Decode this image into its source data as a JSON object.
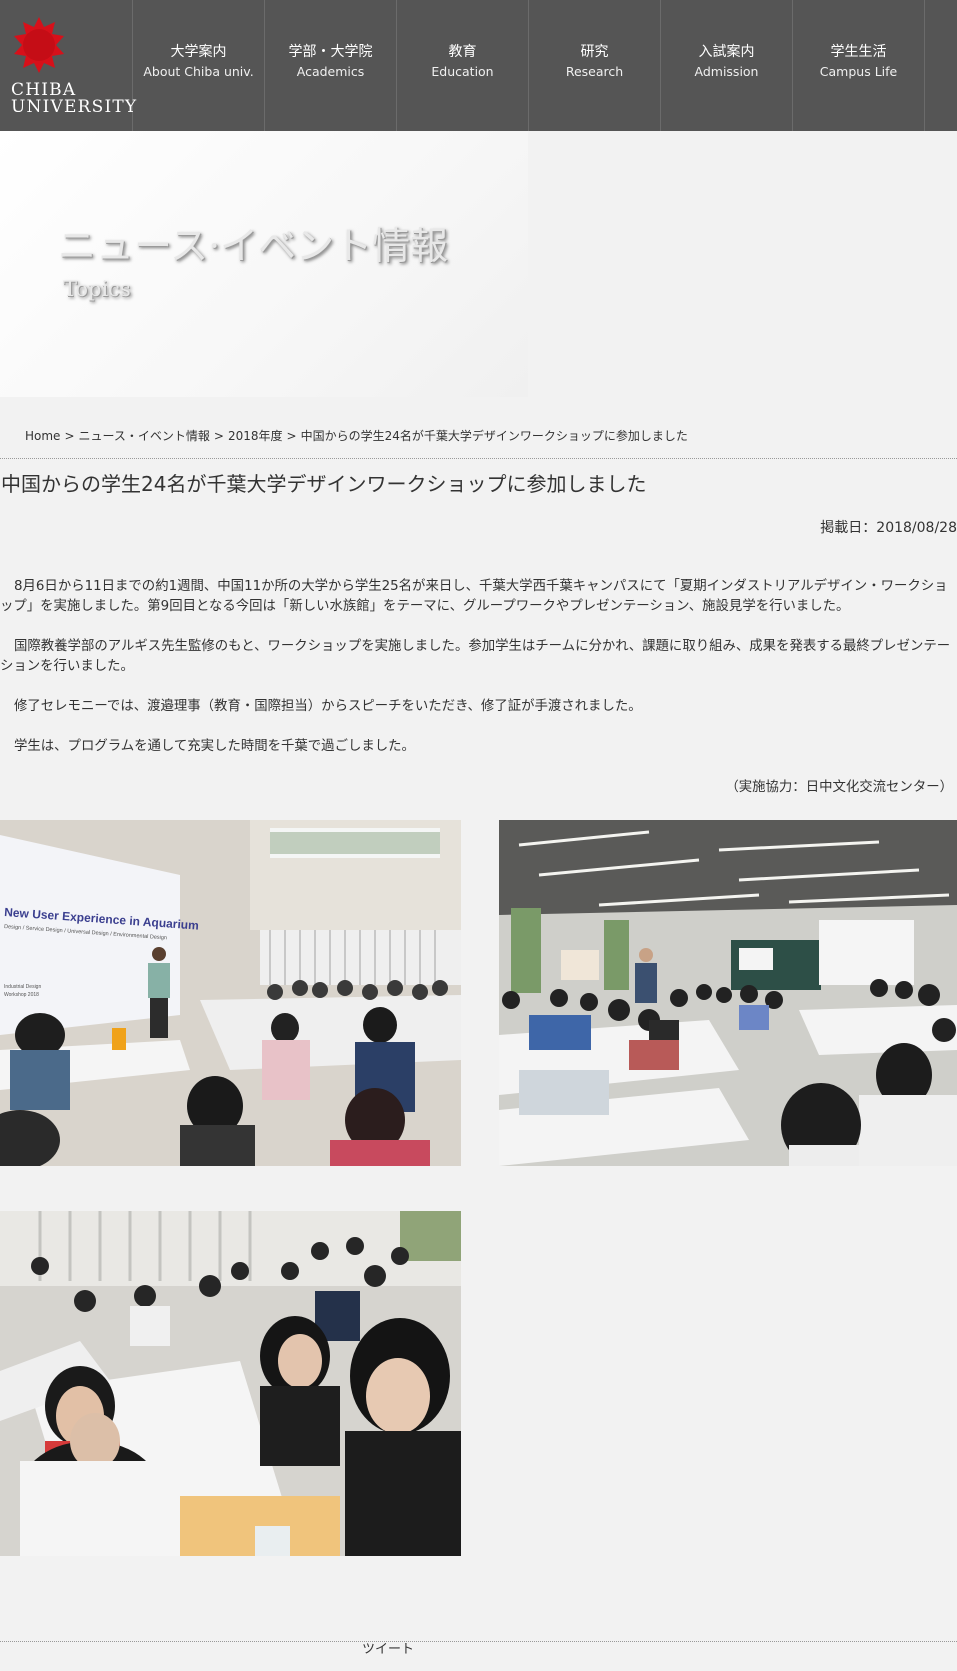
{
  "header": {
    "logo_text_line1": "CHIBA",
    "logo_text_line2": "UNIVERSITY",
    "logo_icon": "red-flower-emblem-icon",
    "nav": [
      {
        "jp": "大学案内",
        "en": "About Chiba univ."
      },
      {
        "jp": "学部・大学院",
        "en": "Academics"
      },
      {
        "jp": "教育",
        "en": "Education"
      },
      {
        "jp": "研究",
        "en": "Research"
      },
      {
        "jp": "入試案内",
        "en": "Admission"
      },
      {
        "jp": "学生生活",
        "en": "Campus Life"
      }
    ]
  },
  "hero": {
    "title": "ニュース·イベント情報",
    "subtitle": "Topics"
  },
  "breadcrumb": {
    "home": "Home",
    "news": "ニュース・イベント情報",
    "year": "2018年度",
    "current": "中国からの学生24名が千葉大学デザインワークショップに参加しました",
    "separator": ">"
  },
  "article": {
    "title": "中国からの学生24名が千葉大学デザインワークショップに参加しました",
    "date": "掲載日：2018/08/28",
    "paragraphs": [
      "8月6日から11日までの約1週間、中国11か所の大学から学生25名が来日し、千葉大学西千葉キャンパスにて「夏期インダストリアルデザイン・ワークショップ」を実施しました。第9回目となる今回は「新しい水族館」をテーマに、グループワークやプレゼンテーション、施設見学を行いました。",
      "国際教養学部のアルギス先生監修のもと、ワークショップを実施しました。参加学生はチームに分かれ、課題に取り組み、成果を発表する最終プレゼンテーションを行いました。",
      "修了セレモニーでは、渡邉理事（教育・国際担当）からスピーチをいただき、修了証が手渡されました。",
      "学生は、プログラムを通して充実した時間を千葉で過ごしました。"
    ],
    "credit": "（実施協力：日中文化交流センター）"
  },
  "photos": {
    "photo1_slide_title": "New User Experience in Aquarium",
    "photo1_slide_sub": "Design / Service Design / Universal Design / Environmental Design",
    "photo1_slide_foot1": "Industrial Design",
    "photo1_slide_foot2": "Workshop 2018"
  },
  "footer": {
    "tweet": "ツイート"
  },
  "colors": {
    "header_bg": "#555555",
    "page_bg": "#f2f2f2",
    "logo_red": "#d7101a"
  }
}
